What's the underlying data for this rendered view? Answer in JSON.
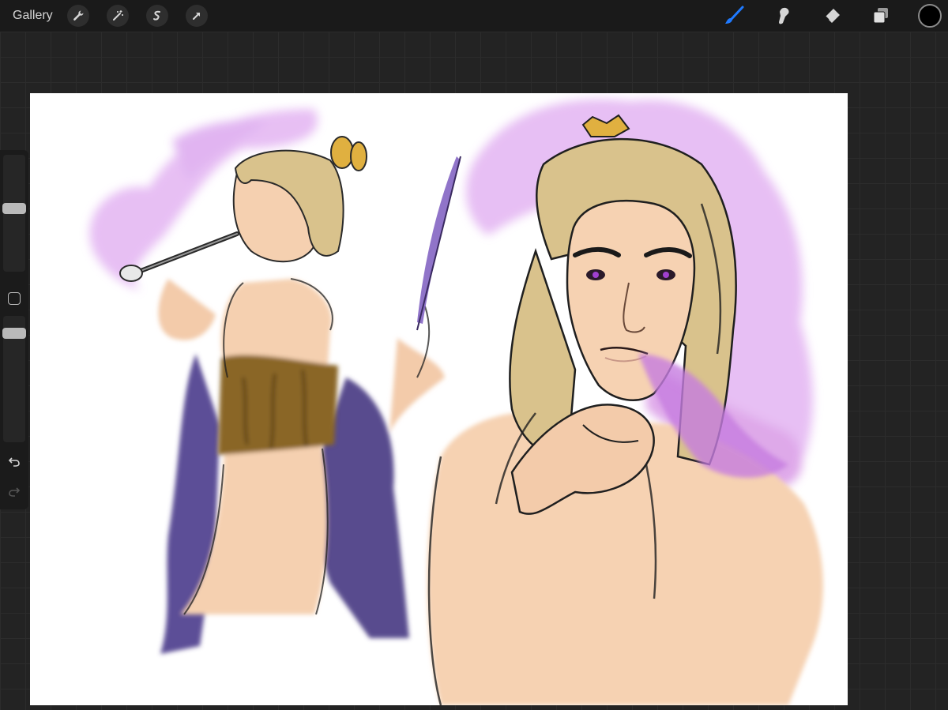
{
  "topbar": {
    "gallery_label": "Gallery",
    "left_tools": [
      "wrench-icon",
      "magic-wand-icon",
      "selection-icon",
      "transform-arrow-icon"
    ],
    "right_tools": [
      "brush-icon",
      "smudge-icon",
      "eraser-icon",
      "layers-icon"
    ],
    "active_tool": "brush",
    "current_color": "#000000",
    "accent_color": "#1f7aff"
  },
  "sidebar": {
    "size_slider_level": 0.35,
    "opacity_slider_level": 0.2,
    "controls": [
      "modify-button",
      "undo-icon",
      "redo-icon"
    ]
  },
  "canvas": {
    "background": "#ffffff",
    "colors": {
      "smoke": "#e3b4f2",
      "hair": "#d8c28c",
      "skin": "#f6d2b2",
      "robe": "#4a3a8a",
      "corset": "#8a6628",
      "outline": "#1a1a1a"
    }
  }
}
